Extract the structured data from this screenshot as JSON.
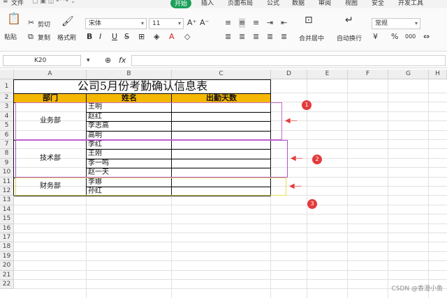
{
  "menu": {
    "file": "文件",
    "start": "开始",
    "insert": "插入",
    "page_layout": "页面布局",
    "formula": "公式",
    "data": "数据",
    "review": "审阅",
    "view": "视图",
    "security": "安全",
    "dev_tools": "开发工具"
  },
  "ribbon": {
    "cut": "剪切",
    "paste": "粘贴",
    "copy": "复制",
    "format_painter": "格式刷",
    "font_name": "宋体",
    "font_size": "11",
    "bold": "B",
    "italic": "I",
    "underline": "U",
    "merge_center": "合并居中",
    "wrap_text": "自动换行",
    "number_format": "常规",
    "percent": "%",
    "thousands": "000"
  },
  "formula_bar": {
    "name_box": "K20",
    "fx": "fx"
  },
  "columns": [
    "A",
    "B",
    "C",
    "D",
    "E",
    "F",
    "G",
    "H"
  ],
  "rows": [
    "1",
    "2",
    "3",
    "4",
    "5",
    "6",
    "7",
    "8",
    "9",
    "10",
    "11",
    "12",
    "13",
    "14",
    "15",
    "16",
    "17",
    "18",
    "19",
    "20",
    "21",
    "22"
  ],
  "sheet": {
    "title": "公司5月份考勤确认信息表",
    "headers": {
      "dept": "部门",
      "name": "姓名",
      "days": "出勤天数"
    },
    "groups": [
      {
        "dept": "业务部",
        "names": [
          "王明",
          "赵红",
          "李志高",
          "高明"
        ]
      },
      {
        "dept": "技术部",
        "names": [
          "李红",
          "王刚",
          "李一鸣",
          "赵一天"
        ]
      },
      {
        "dept": "财务部",
        "names": [
          "李娜",
          "孙红"
        ]
      }
    ]
  },
  "callouts": [
    "1",
    "2",
    "3"
  ],
  "colors": {
    "header_fill": "#f5b800",
    "group1_outline": "#c86bc8",
    "group2_outline": "#b04fd6",
    "group3_outline": "#e6e055",
    "callout": "#e23b3b",
    "start_tab": "#1aa05a"
  },
  "watermark": "CSDN @香澄小鱼"
}
